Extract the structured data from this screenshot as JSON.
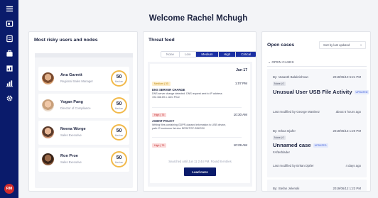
{
  "header": {
    "welcome": "Welcome Rachel Mchugh"
  },
  "sidebar": {
    "icons": [
      "menu-icon",
      "cases-icon",
      "reports-icon",
      "briefcase-icon",
      "dashboard-icon",
      "chart-icon",
      "settings-icon"
    ],
    "avatar_initials": "RM",
    "avatar_color": "#d02a2a",
    "bg_color": "#0a1b6b"
  },
  "risky": {
    "title": "Most risky users and nodes",
    "users": [
      {
        "name": "Ana Garrett",
        "role": "Regional Sales Manager",
        "score": "50",
        "level": "Medium"
      },
      {
        "name": "Yogan Pang",
        "role": "Director of Compliance",
        "score": "50",
        "level": "Medium"
      },
      {
        "name": "Neena Worge",
        "role": "Sales Executive",
        "score": "50",
        "level": "Medium"
      },
      {
        "name": "Ron Proe",
        "role": "Sales Executive",
        "score": "50",
        "level": "Medium"
      }
    ]
  },
  "threat": {
    "title": "Threat feed",
    "tabs": [
      "None",
      "Low",
      "Medium",
      "High",
      "Critical"
    ],
    "active_tabs": [
      "Medium",
      "High",
      "Critical"
    ],
    "date": "Jun 17",
    "items": [
      {
        "badge": "Medium | 30",
        "time": "1:07 PM",
        "type": "DNS SERVER CHANGE",
        "desc": "DNS server change detected. DNS request sent to IP address 192.168.69.1. Alex Price"
      },
      {
        "badge": "High | 75",
        "time": "10:30 AM",
        "type": "AGENT POLICY",
        "desc": "Writing files containing GDPR-classed information to USB device, path: E:\\customer list.xlsx DESKTOP-SBKS3X"
      },
      {
        "badge": "High | 75",
        "time": "10:29 AM",
        "type": "",
        "desc": ""
      }
    ],
    "footer": "Searched until Jun 11 2:44 PM. Found 8 entries",
    "load_more": "Load more"
  },
  "cases": {
    "title": "Open cases",
    "sort_label": "Sort by last updated",
    "section": "OPEN CASES",
    "items": [
      {
        "by": "By: Vasanth Balakrishnan",
        "date": "2019/06/10 5:21 PM",
        "badge": "None | 0",
        "title": "Unusual User USB File Activity",
        "updated": "UPDATED",
        "tag": "",
        "modified": "Last modified by George Martinez",
        "ago": "about 6 hours ago"
      },
      {
        "by": "By: Erkan Djafer",
        "date": "2019/06/13 1:20 PM",
        "badge": "None | 0",
        "title": "Unnamed case",
        "updated": "UPDATED",
        "tag": "#Afterblader",
        "modified": "Last modified by Erkan Djafer",
        "ago": "4 days ago"
      },
      {
        "by": "By: Stefan Jelenski",
        "date": "2019/06/12 1:23 PM",
        "badge": "",
        "title": "",
        "updated": "",
        "tag": "",
        "modified": "",
        "ago": ""
      }
    ]
  }
}
